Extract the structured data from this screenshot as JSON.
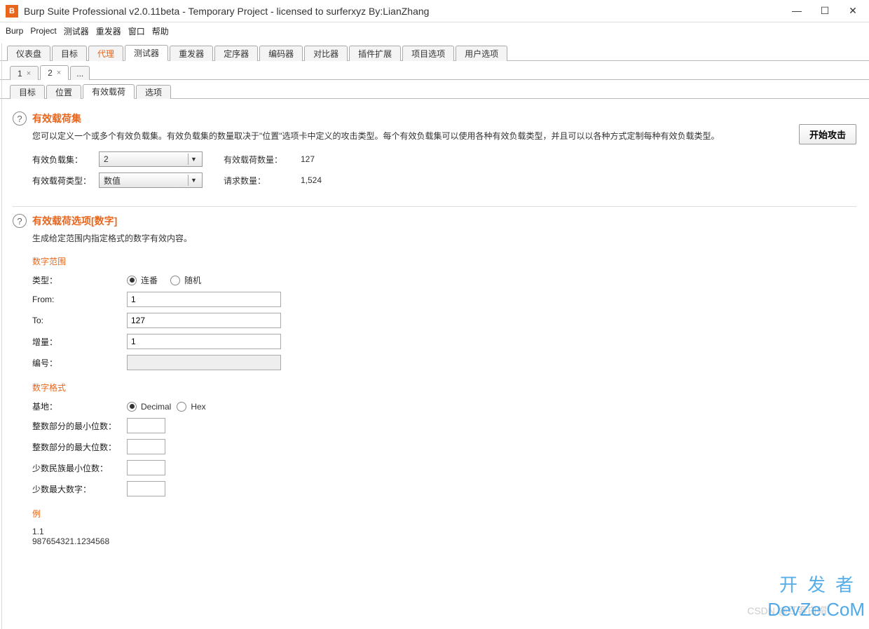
{
  "window": {
    "title": "Burp Suite Professional v2.0.11beta - Temporary Project - licensed to surferxyz By:LianZhang"
  },
  "menubar": [
    "Burp",
    "Project",
    "测试器",
    "重发器",
    "窗口",
    "帮助"
  ],
  "main_tabs": [
    "仪表盘",
    "目标",
    "代理",
    "测试器",
    "重发器",
    "定序器",
    "编码器",
    "对比器",
    "插件扩展",
    "项目选项",
    "用户选项"
  ],
  "main_tabs_active_index": 3,
  "main_tabs_orange_index": 2,
  "num_tabs": {
    "items": [
      "1",
      "2"
    ],
    "active_index": 1,
    "more": "..."
  },
  "sub_tabs": [
    "目标",
    "位置",
    "有效载荷",
    "选项"
  ],
  "sub_tabs_active_index": 2,
  "buttons": {
    "start_attack": "开始攻击"
  },
  "payload_sets": {
    "title": "有效载荷集",
    "desc": "您可以定义一个或多个有效负载集。有效负载集的数量取决于\"位置\"选项卡中定义的攻击类型。每个有效负载集可以使用各种有效负载类型，并且可以以各种方式定制每种有效负载类型。",
    "set_label": "有效负载集：",
    "set_value": "2",
    "type_label": "有效载荷类型：",
    "type_value": "数值",
    "count_label": "有效载荷数量：",
    "count_value": "127",
    "req_label": "请求数量：",
    "req_value": "1,524"
  },
  "payload_options": {
    "title": "有效载荷选项[数字]",
    "desc": "生成给定范围内指定格式的数字有效内容。",
    "range_heading": "数字范围",
    "type_label": "类型：",
    "type_seq": "连番",
    "type_rand": "随机",
    "type_selected": "seq",
    "from_label": "From:",
    "from_value": "1",
    "to_label": "To:",
    "to_value": "127",
    "step_label": "增量：",
    "step_value": "1",
    "count_label": "编号：",
    "count_value": "",
    "format_heading": "数字格式",
    "base_label": "基地：",
    "base_dec": "Decimal",
    "base_hex": "Hex",
    "base_selected": "dec",
    "min_int_label": "整数部分的最小位数：",
    "min_int_value": "",
    "max_int_label": "整数部分的最大位数：",
    "max_int_value": "",
    "min_frac_label": "少数民族最小位数：",
    "min_frac_value": "",
    "max_frac_label": "少数最大数字：",
    "max_frac_value": "",
    "example_heading": "例",
    "example1": "1.1",
    "example2": "987654321.1234568"
  },
  "watermarks": {
    "line1": "开发者",
    "line2": "DevZe.CoM",
    "faint": "CSDN @红客白帽"
  }
}
